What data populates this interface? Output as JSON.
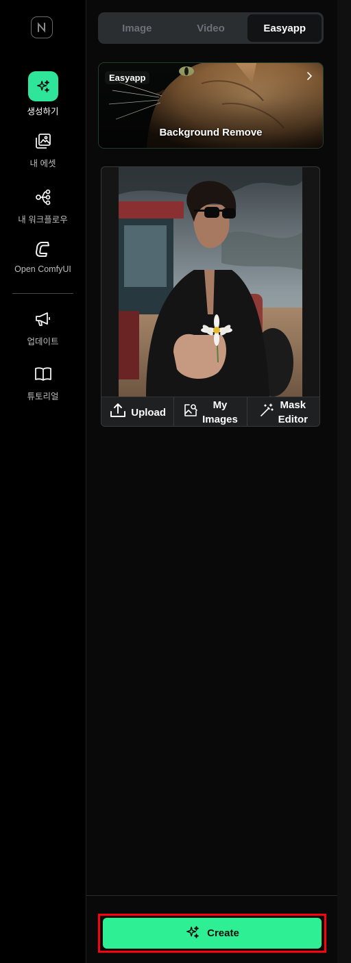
{
  "sidebar": {
    "logo_icon": "brand-logo-icon",
    "items": [
      {
        "label": "생성하기",
        "icon": "sparkle-icon",
        "active": true
      },
      {
        "label": "내 에셋",
        "icon": "image-stack-icon",
        "active": false
      },
      {
        "label": "내 워크플로우",
        "icon": "workflow-icon",
        "active": false
      },
      {
        "label": "Open ComfyUI",
        "icon": "comfyui-icon",
        "active": false
      },
      {
        "label": "업데이트",
        "icon": "megaphone-icon",
        "active": false
      },
      {
        "label": "튜토리얼",
        "icon": "book-icon",
        "active": false
      }
    ],
    "accent_color": "#2fe59a"
  },
  "tabs": [
    {
      "label": "Image",
      "active": false
    },
    {
      "label": "Video",
      "active": false
    },
    {
      "label": "Easyapp",
      "active": true
    }
  ],
  "banner": {
    "badge": "Easyapp",
    "title": "Background Remove",
    "chevron_icon": "chevron-right-icon"
  },
  "image_card": {
    "actions": [
      {
        "label": "Upload",
        "icon": "upload-icon"
      },
      {
        "label": "My\nImages",
        "icon": "image-search-icon"
      },
      {
        "label": "Mask\nEditor",
        "icon": "magic-wand-icon"
      }
    ]
  },
  "create_button": {
    "label": "Create",
    "icon": "sparkle-icon",
    "color": "#2fef94",
    "highlight_color": "#ff0010"
  }
}
